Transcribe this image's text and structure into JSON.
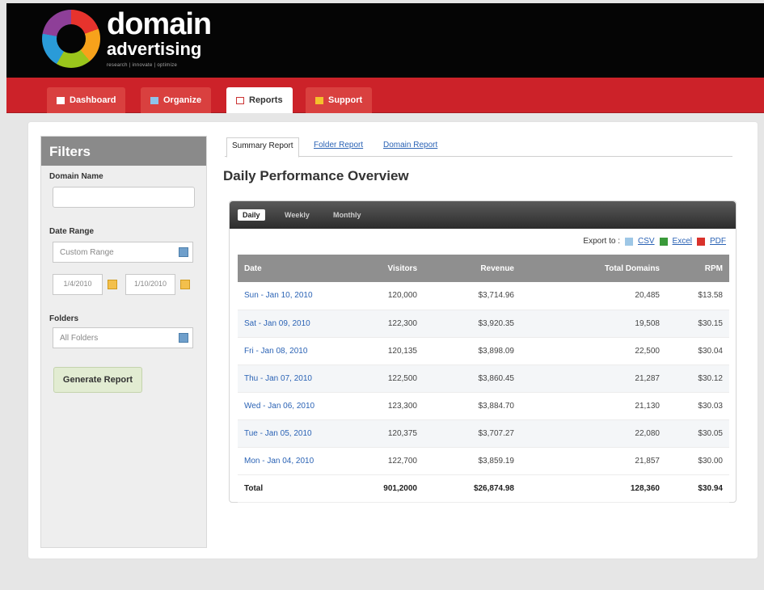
{
  "brand": {
    "name_line1": "domain",
    "name_line2": "advertising",
    "tagline": "research | innovate | optimize"
  },
  "nav": {
    "tabs": [
      {
        "label": "Dashboard",
        "icon": "folder-icon"
      },
      {
        "label": "Organize",
        "icon": "organize-icon"
      },
      {
        "label": "Reports",
        "icon": "reports-icon"
      },
      {
        "label": "Support",
        "icon": "support-icon"
      }
    ],
    "active": "Reports"
  },
  "filters": {
    "title": "Filters",
    "domain_label": "Domain Name",
    "domain_value": "",
    "date_range_label": "Date Range",
    "date_range_value": "Custom Range",
    "date_from": "1/4/2010",
    "date_to": "1/10/2010",
    "folders_label": "Folders",
    "folders_value": "All Folders",
    "generate_label": "Generate Report"
  },
  "report_tabs": [
    "Summary Report",
    "Folder Report",
    "Domain Report"
  ],
  "page_title": "Daily Performance Overview",
  "period_tabs": [
    "Daily",
    "Weekly",
    "Monthly"
  ],
  "export": {
    "label": "Export to :",
    "csv": "CSV",
    "excel": "Excel",
    "pdf": "PDF"
  },
  "table": {
    "headers": [
      "Date",
      "Visitors",
      "Revenue",
      "Total Domains",
      "RPM"
    ],
    "rows": [
      [
        "Sun - Jan 10, 2010",
        "120,000",
        "$3,714.96",
        "20,485",
        "$13.58"
      ],
      [
        "Sat - Jan 09, 2010",
        "122,300",
        "$3,920.35",
        "19,508",
        "$30.15"
      ],
      [
        "Fri - Jan 08, 2010",
        "120,135",
        "$3,898.09",
        "22,500",
        "$30.04"
      ],
      [
        "Thu - Jan 07, 2010",
        "122,500",
        "$3,860.45",
        "21,287",
        "$30.12"
      ],
      [
        "Wed - Jan 06, 2010",
        "123,300",
        "$3,884.70",
        "21,130",
        "$30.03"
      ],
      [
        "Tue - Jan 05, 2010",
        "120,375",
        "$3,707.27",
        "22,080",
        "$30.05"
      ],
      [
        "Mon - Jan 04, 2010",
        "122,700",
        "$3,859.19",
        "21,857",
        "$30.00"
      ]
    ],
    "total": [
      "Total",
      "901,2000",
      "$26,874.98",
      "128,360",
      "$30.94"
    ]
  }
}
